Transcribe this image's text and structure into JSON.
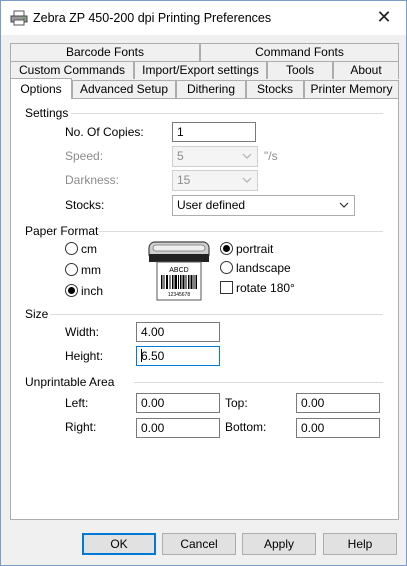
{
  "window": {
    "title": "Zebra  ZP 450-200 dpi Printing Preferences",
    "close_glyph": "✕"
  },
  "tabs": {
    "row1": [
      "Barcode Fonts",
      "Command Fonts"
    ],
    "row2": [
      "Custom Commands",
      "Import/Export settings",
      "Tools",
      "About"
    ],
    "row3": [
      "Options",
      "Advanced Setup",
      "Dithering",
      "Stocks",
      "Printer Memory"
    ],
    "active": "Options"
  },
  "settings": {
    "group_title": "Settings",
    "copies_label": "No. Of Copies:",
    "copies_value": "1",
    "speed_label": "Speed:",
    "speed_value": "5",
    "speed_unit": "\"/s",
    "darkness_label": "Darkness:",
    "darkness_value": "15",
    "stocks_label": "Stocks:",
    "stocks_value": "User defined"
  },
  "paper_format": {
    "group_title": "Paper Format",
    "units": [
      {
        "label": "cm",
        "checked": false
      },
      {
        "label": "mm",
        "checked": false
      },
      {
        "label": "inch",
        "checked": true
      }
    ],
    "orientation": [
      {
        "label": "portrait",
        "checked": true
      },
      {
        "label": "landscape",
        "checked": false
      }
    ],
    "rotate_label": "rotate 180°",
    "rotate_checked": false,
    "label_preview_text": "ABCD",
    "label_preview_number": "12345678"
  },
  "size": {
    "group_title": "Size",
    "width_label": "Width:",
    "width_value": "4.00",
    "height_label": "Height:",
    "height_value": "6.50"
  },
  "unprintable": {
    "group_title": "Unprintable Area",
    "left_label": "Left:",
    "left_value": "0.00",
    "top_label": "Top:",
    "top_value": "0.00",
    "right_label": "Right:",
    "right_value": "0.00",
    "bottom_label": "Bottom:",
    "bottom_value": "0.00"
  },
  "buttons": {
    "ok": "OK",
    "cancel": "Cancel",
    "apply": "Apply",
    "help": "Help"
  },
  "colors": {
    "focus_border": "#0078d7",
    "disabled_text": "#8c8c8c"
  }
}
